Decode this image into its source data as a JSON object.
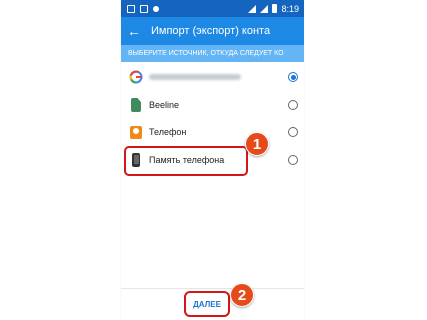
{
  "colors": {
    "status_bar": "#1565c0",
    "app_bar": "#1e88e5",
    "section_bar": "#64b5f6",
    "accent": "#1976d2",
    "annotation_badge": "#e54b1a"
  },
  "status_bar": {
    "icons": [
      "google-mini-icon",
      "image-icon",
      "notification-dot-icon",
      "wifi-icon",
      "signal-icon",
      "battery-icon"
    ],
    "time": "8:19"
  },
  "app_bar": {
    "back_icon": "arrow-left-icon",
    "title": "Импорт (экспорт) конта"
  },
  "section": {
    "label": "ВЫБЕРИТЕ ИСТОЧНИК, ОТКУДА СЛЕДУЕТ КО"
  },
  "sources": [
    {
      "icon": "google-icon",
      "label": "",
      "selected": true
    },
    {
      "icon": "sim-card-icon",
      "label": "Beeline",
      "selected": false
    },
    {
      "icon": "contact-icon",
      "label": "Телефон",
      "selected": false
    },
    {
      "icon": "phone-icon",
      "label": "Память телефона",
      "selected": false
    }
  ],
  "footer": {
    "next_label": "ДАЛЕЕ"
  },
  "annotations": {
    "step1": "1",
    "step2": "2"
  }
}
